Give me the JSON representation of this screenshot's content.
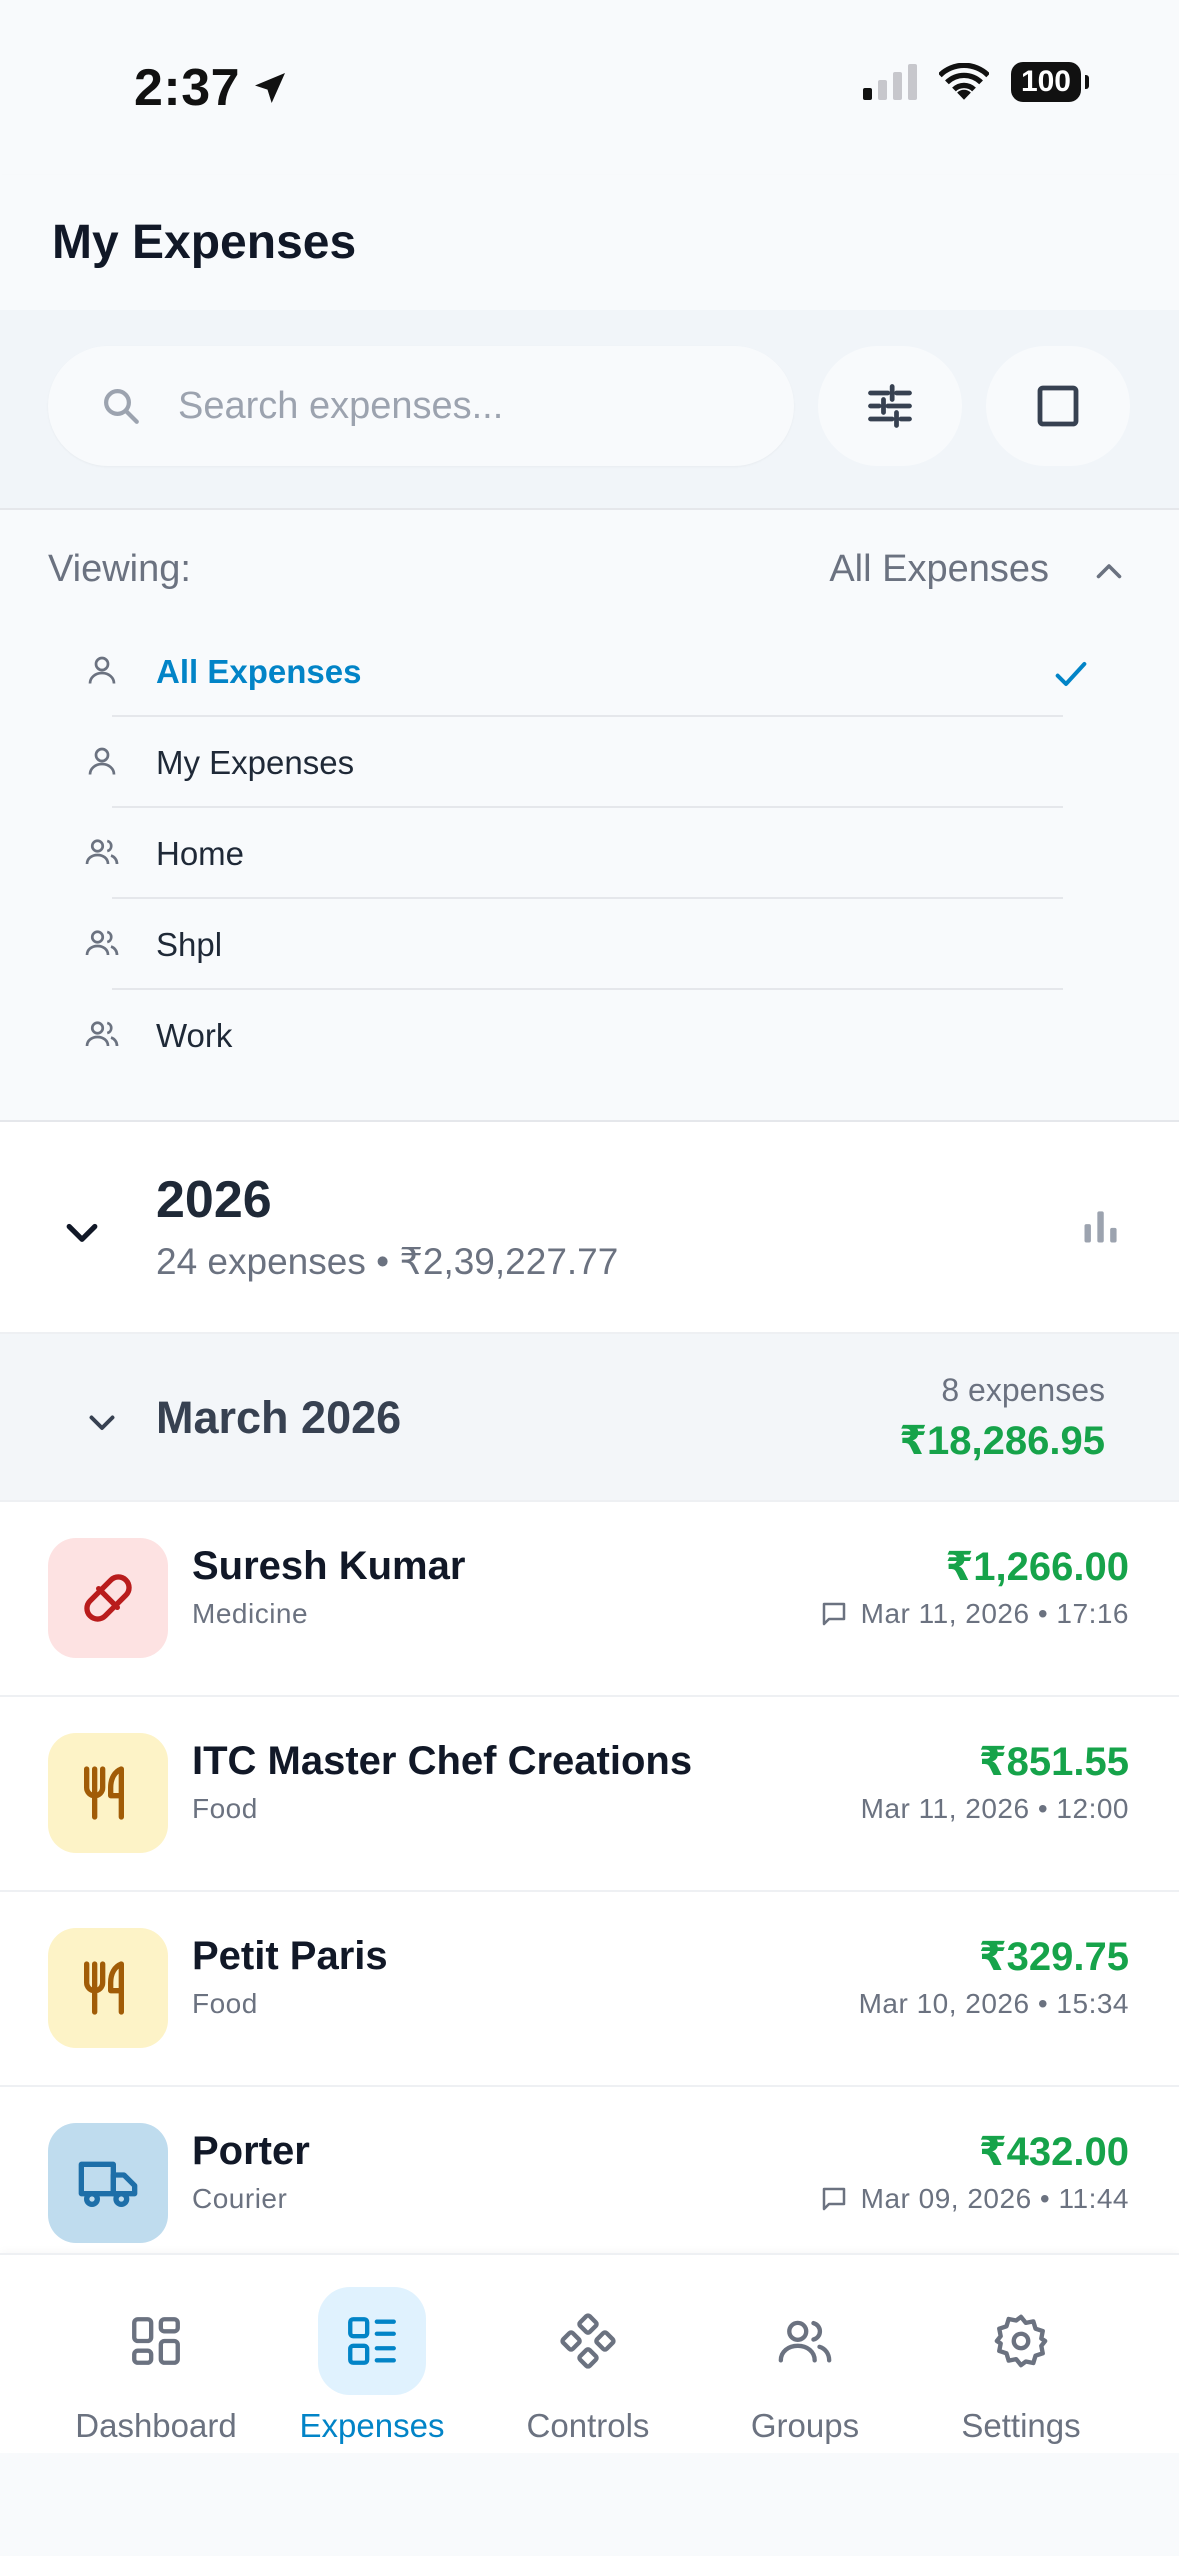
{
  "status_bar": {
    "time": "2:37",
    "battery": "100"
  },
  "header": {
    "title": "My Expenses"
  },
  "search": {
    "placeholder": "Search expenses..."
  },
  "viewing": {
    "label": "Viewing:",
    "selected": "All Expenses",
    "options": [
      {
        "label": "All Expenses",
        "icon": "user-icon"
      },
      {
        "label": "My Expenses",
        "icon": "user-icon"
      },
      {
        "label": "Home",
        "icon": "users-icon"
      },
      {
        "label": "Shpl",
        "icon": "users-icon"
      },
      {
        "label": "Work",
        "icon": "users-icon"
      }
    ]
  },
  "year": {
    "title": "2026",
    "subtitle": "24 expenses • ₹2,39,227.77"
  },
  "month": {
    "title": "March 2026",
    "count": "8 expenses",
    "total": "₹18,286.95"
  },
  "expenses": [
    {
      "title": "Suresh Kumar",
      "category": "Medicine",
      "amount": "₹1,266.00",
      "date": "Mar 11, 2026 • 17:16",
      "has_note": true,
      "icon": "pill-icon",
      "icon_bg": "#fde2e2",
      "icon_color": "#b91c1c"
    },
    {
      "title": "ITC Master Chef Creations",
      "category": "Food",
      "amount": "₹851.55",
      "date": "Mar 11, 2026 • 12:00",
      "has_note": false,
      "icon": "utensils-icon",
      "icon_bg": "#fdf3c7",
      "icon_color": "#a15c07"
    },
    {
      "title": "Petit Paris",
      "category": "Food",
      "amount": "₹329.75",
      "date": "Mar 10, 2026 • 15:34",
      "has_note": false,
      "icon": "utensils-icon",
      "icon_bg": "#fdf3c7",
      "icon_color": "#a15c07"
    },
    {
      "title": "Porter",
      "category": "Courier",
      "amount": "₹432.00",
      "date": "Mar 09, 2026 • 11:44",
      "has_note": true,
      "icon": "truck-icon",
      "icon_bg": "#bfdcee",
      "icon_color": "#1e6fa8"
    }
  ],
  "nav": {
    "items": [
      {
        "label": "Dashboard",
        "icon": "dashboard-icon"
      },
      {
        "label": "Expenses",
        "icon": "expenses-list-icon"
      },
      {
        "label": "Controls",
        "icon": "controls-icon"
      },
      {
        "label": "Groups",
        "icon": "groups-icon"
      },
      {
        "label": "Settings",
        "icon": "gear-icon"
      }
    ],
    "active": "Expenses"
  },
  "colors": {
    "accent": "#0284c7",
    "positive": "#16a34a",
    "muted": "#6b7280"
  }
}
